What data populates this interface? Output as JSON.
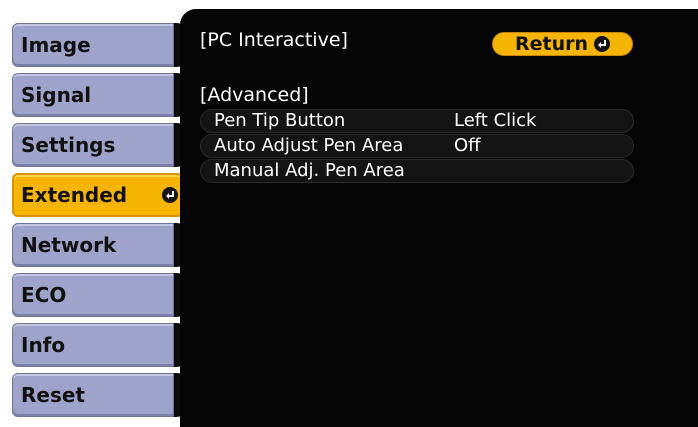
{
  "sidebar": {
    "items": [
      {
        "label": "Image"
      },
      {
        "label": "Signal"
      },
      {
        "label": "Settings"
      },
      {
        "label": "Extended",
        "selected": true
      },
      {
        "label": "Network"
      },
      {
        "label": "ECO"
      },
      {
        "label": "Info"
      },
      {
        "label": "Reset"
      }
    ]
  },
  "header": {
    "title": "[PC Interactive]",
    "return_label": "Return"
  },
  "section": {
    "label": "[Advanced]"
  },
  "settings": {
    "rows": [
      {
        "name": "Pen Tip Button",
        "value": "Left Click"
      },
      {
        "name": "Auto Adjust Pen Area",
        "value": "Off"
      },
      {
        "name": "Manual Adj. Pen Area",
        "value": ""
      }
    ]
  },
  "colors": {
    "menu_button": "#9ea3c9",
    "highlight": "#f5b400",
    "panel": "#050505",
    "text_light": "#ffffff",
    "text_dark": "#111111"
  },
  "icons": {
    "enter": "enter-icon"
  }
}
